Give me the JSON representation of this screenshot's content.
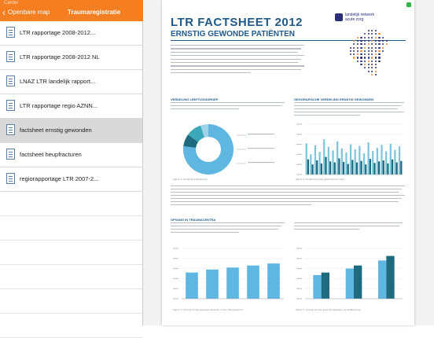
{
  "status": {
    "carrier": "Carrier"
  },
  "nav": {
    "back_label": "Openbare map",
    "title": "Traumaregistratie"
  },
  "documents": [
    {
      "label": "LTR rapportage 2008-2012..."
    },
    {
      "label": "LTR rapportage 2008-2012 NL"
    },
    {
      "label": "LNAZ LTR landelijk rapport..."
    },
    {
      "label": "LTR rapportage regio AZNN..."
    },
    {
      "label": "factsheet ernstig gewonden"
    },
    {
      "label": "factsheet heupfracturen"
    },
    {
      "label": "regiorapportage LTR 2007-2..."
    }
  ],
  "selected_index": 4,
  "doc": {
    "title": "LTR FACTSHEET 2012",
    "subtitle": "ERNSTIG GEWONDE PATIËNTEN",
    "logo": {
      "line1": "landelijk netwerk",
      "line2": "acute zorg"
    },
    "sections": {
      "age": "VERDELING LEEFTIJDSGROEP",
      "region": "GEOGRAFISCHE VERDELING ERNSTIG GEWONDEN",
      "opvang": "OPVANG IN TRAUMACENTRA"
    },
    "fig1_caption": "Figuur 1. Verdeling leeftijdsgroep",
    "fig2_caption": "Figuur 2. Verdeling ernstig gewonden per regio",
    "fig3_caption": "Figuur 3. Opvang ernstig gewonde patiënten in een traumacentrum",
    "fig4_caption": "Figuur 4. Opvang ernstig gewonde patiënten per leeftijdsgroep"
  },
  "colors": {
    "accent": "#f57e21",
    "doc_blue": "#1f5a8a",
    "chart_teal": "#3aa8b8",
    "chart_dark": "#1e6b80"
  },
  "chart_data": [
    {
      "type": "pie",
      "values": [
        77,
        8,
        10,
        5
      ],
      "note": "donut, mostly light blue"
    },
    {
      "type": "bar",
      "series": [
        {
          "values": [
            62,
            40,
            58,
            45,
            70,
            55,
            48,
            66,
            52,
            44,
            60,
            50,
            57,
            42,
            64,
            47,
            53,
            59,
            46,
            61,
            49,
            56
          ]
        },
        {
          "values": [
            30,
            20,
            28,
            22,
            35,
            26,
            24,
            32,
            25,
            21,
            29,
            24,
            27,
            20,
            31,
            23,
            26,
            28,
            22,
            30,
            24,
            27
          ]
        }
      ],
      "ylim": [
        0,
        100
      ]
    },
    {
      "type": "bar",
      "categories": [
        "2008",
        "2009",
        "2010",
        "2011",
        "2012"
      ],
      "values": [
        52,
        58,
        62,
        66,
        70
      ],
      "ylim": [
        0,
        100
      ]
    },
    {
      "type": "bar",
      "series": [
        {
          "values": [
            47,
            60,
            76
          ]
        },
        {
          "values": [
            52,
            66,
            85
          ]
        }
      ],
      "ylim": [
        0,
        100
      ]
    }
  ]
}
